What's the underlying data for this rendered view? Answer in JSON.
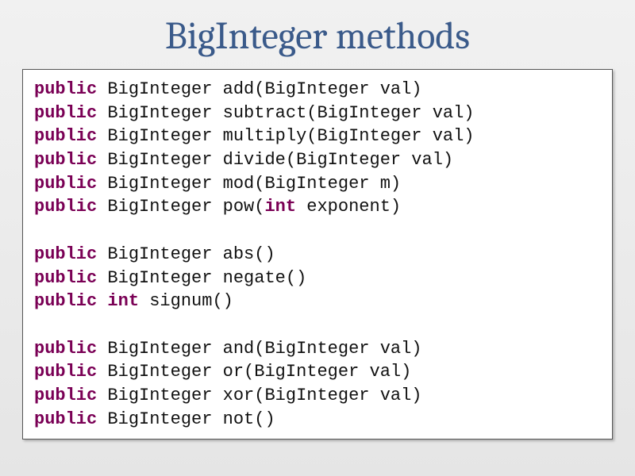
{
  "title": "BigInteger methods",
  "code": {
    "kw_public": "public",
    "type_BigInteger": "BigInteger",
    "type_int": "int",
    "methods": {
      "add": "add(BigInteger val)",
      "subtract": "subtract(BigInteger val)",
      "multiply": "multiply(BigInteger val)",
      "divide": "divide(BigInteger val)",
      "mod": "mod(BigInteger m)",
      "pow_pre": "pow(",
      "pow_post": " exponent)",
      "abs": "abs()",
      "negate": "negate()",
      "signum": "signum()",
      "and": "and(BigInteger val)",
      "or": "or(BigInteger val)",
      "xor": "xor(BigInteger val)",
      "not": "not()"
    }
  }
}
